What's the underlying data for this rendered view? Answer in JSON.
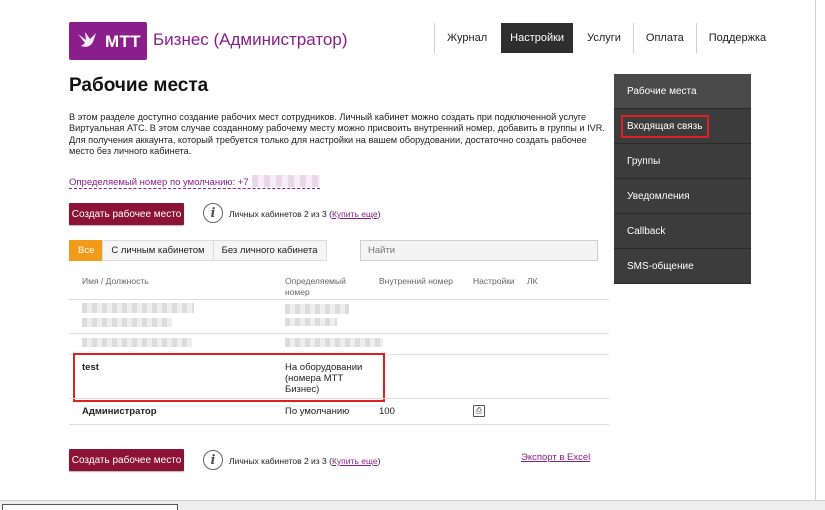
{
  "brand": {
    "logo_text": "МТТ",
    "title": "Бизнес (Администратор)",
    "color": "#8a1e8a"
  },
  "nav": {
    "items": [
      "Журнал",
      "Настройки",
      "Услуги",
      "Оплата",
      "Поддержка"
    ],
    "active": "Настройки"
  },
  "side_menu": {
    "items": [
      "Рабочие места",
      "Входящая связь",
      "Группы",
      "Уведомления",
      "Callback",
      "SMS-общение"
    ],
    "highlighted": "Входящая связь"
  },
  "page": {
    "title": "Рабочие места",
    "intro_line1": "В этом разделе доступно создание рабочих мест сотрудников. Личный кабинет можно создать при подключенной услуге Виртуальная АТС. В этом случае созданному рабочему месту можно присвоить внутренний номер, добавить в группы и IVR.",
    "intro_line2": "Для получения аккаунта, который требуется только для настройки на вашем оборудовании, достаточно создать рабочее место без личного кабинета.",
    "default_number_label": "Определяемый номер по умолчанию: +7"
  },
  "actions": {
    "create_label": "Создать рабочее место",
    "info_icon": "i",
    "cabinets_count": "Личных кабинетов 2 из 3 (",
    "buy_more": "Купить еще",
    "cabinets_close": ")",
    "export_label": "Экспорт в Excel"
  },
  "filters": {
    "tabs": [
      "Все",
      "С личным кабинетом",
      "Без личного кабинета"
    ],
    "active": "Все",
    "search_placeholder": "Найти"
  },
  "table": {
    "headers": {
      "name": "Имя / Должность",
      "number_line1": "Определяемый",
      "number_line2": "номер",
      "internal": "Внутренний номер",
      "settings": "Настройки",
      "lk": "ЛК"
    },
    "rows": [
      {
        "name": "test",
        "number_line1": "На оборудовании",
        "number_line2": "(номера МТТ",
        "number_line3": "Бизнес)",
        "internal": ""
      },
      {
        "name": "Администратор",
        "number_line1": "По умолчанию",
        "internal": "100"
      }
    ]
  },
  "colors": {
    "button": "#8c1336",
    "tab_active": "#f29a1a",
    "menu_bg": "#3c3c3c",
    "highlight": "#e02020"
  }
}
